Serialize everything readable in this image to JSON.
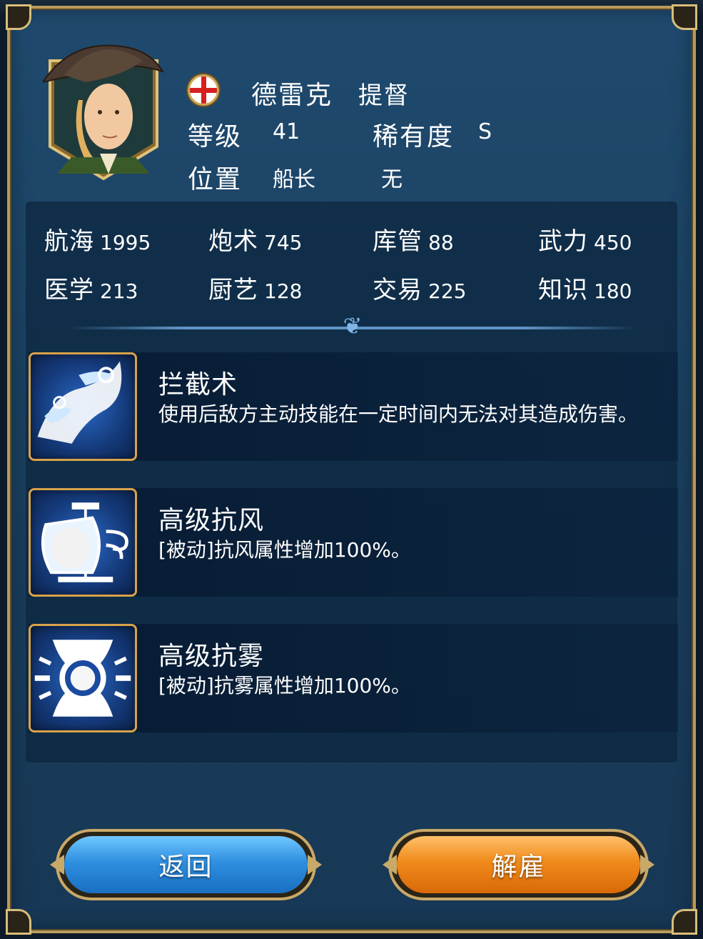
{
  "officer": {
    "name": "德雷克",
    "title": "提督",
    "flag_icon": "england-flag-icon",
    "level_label": "等级",
    "level_value": "41",
    "rarity_label": "稀有度",
    "rarity_value": "S",
    "position_label": "位置",
    "position_value": "船长",
    "position_extra": "无"
  },
  "stats": [
    {
      "label": "航海",
      "value": "1995"
    },
    {
      "label": "炮术",
      "value": "745"
    },
    {
      "label": "库管",
      "value": "88"
    },
    {
      "label": "武力",
      "value": "450"
    },
    {
      "label": "医学",
      "value": "213"
    },
    {
      "label": "厨艺",
      "value": "128"
    },
    {
      "label": "交易",
      "value": "225"
    },
    {
      "label": "知识",
      "value": "180"
    }
  ],
  "skills": [
    {
      "name": "拦截术",
      "desc": "使用后敌方主动技能在一定时间内无法对其造成伤害。",
      "icon": "wave-icon"
    },
    {
      "name": "高级抗风",
      "desc": "[被动]抗风属性增加100%。",
      "icon": "ship-wind-icon"
    },
    {
      "name": "高级抗雾",
      "desc": "[被动]抗雾属性增加100%。",
      "icon": "fog-ring-icon"
    }
  ],
  "buttons": {
    "back_label": "返回",
    "fire_label": "解雇"
  },
  "colors": {
    "panel": "#1f4a6e",
    "frame_gold": "#b89a5a",
    "back_button": "#2f8fe0",
    "fire_button": "#f08a1a",
    "flag_red": "#d62020"
  }
}
